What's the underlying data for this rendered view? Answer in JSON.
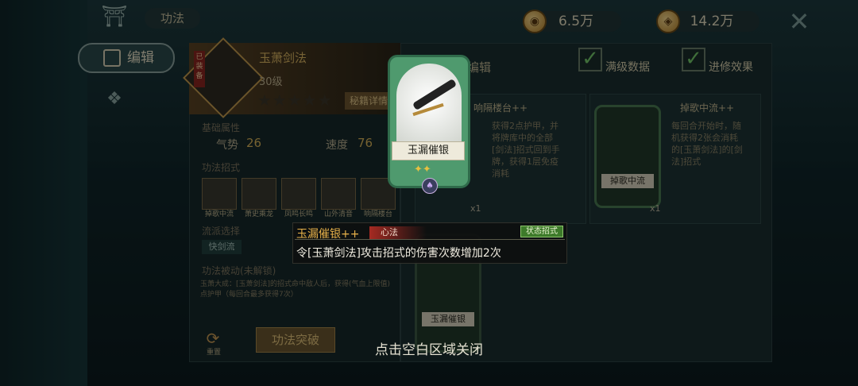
{
  "header": {
    "breadcrumb": "功法",
    "currency_1": "6.5万",
    "currency_2": "14.2万"
  },
  "nav": {
    "edit_label": "编辑"
  },
  "technique": {
    "obtained_tag": "已装备",
    "name": "玉萧剑法",
    "level": "30级",
    "stars": 5,
    "manual_button": "秘籍详情",
    "basic_attr_title": "基础属性",
    "stats": [
      {
        "label": "气势",
        "value": "26"
      },
      {
        "label": "速度",
        "value": "76"
      }
    ],
    "moves_title": "功法招式",
    "moves": [
      "掉歌中流",
      "萧史乘龙",
      "凤鸣长鸣",
      "山外清音",
      "响隔楼台"
    ],
    "advance_title": "流派选择",
    "advance_chip": "快剑流",
    "passive_title": "功法被动(未解锁)",
    "passive_text": "玉萧大成：[玉萧剑法]的招式命中敌人后，获得(气血上限值)点护甲（每回合最多获得7次）",
    "reset_label": "重置",
    "break_button": "功法突破"
  },
  "right_panel": {
    "title": "编辑",
    "options": [
      {
        "label": "满级数据",
        "checked": true
      },
      {
        "label": "进修效果",
        "checked": true
      }
    ],
    "cards": [
      {
        "title": "响隔楼台++",
        "desc": "获得2点护甲，并将牌库中的全部[剑法]招式回到手牌，获得1层免疫消耗",
        "count": "x1"
      },
      {
        "title": "掉歌中流++",
        "desc": "每回合开始时，随机获得2张会消耗的[玉萧剑法]的[剑法]招式",
        "card_label": "掉歌中流",
        "count": "x1"
      }
    ],
    "lower_card_label": "玉漏催银"
  },
  "modal": {
    "card_label": "玉漏催银",
    "name": "玉漏催银++",
    "type": "心法",
    "subtag": "状态招式",
    "description": "令[玉萧剑法]攻击招式的伤害次数增加2次",
    "hint": "点击空白区域关闭"
  }
}
